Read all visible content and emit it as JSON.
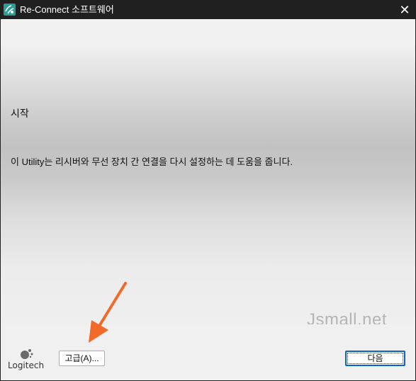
{
  "window": {
    "title": "Re-Connect 소프트웨어",
    "close_glyph": "✕"
  },
  "main": {
    "heading": "시작",
    "description": "이 Utility는 리시버와 무선 장치 간 연결을 다시 설정하는 데 도움을 줍니다.",
    "watermark": "Jsmall.net"
  },
  "footer": {
    "logo_text": "Logitech",
    "advanced_label": "고급(A)...",
    "next_label": "다음"
  },
  "colors": {
    "titlebar": "#202020",
    "app_icon": "#2b9e99",
    "arrow": "#f26a2a",
    "default_button_border": "#0a64c8"
  },
  "icons": [
    "app-icon",
    "close-icon",
    "logitech-logo-icon",
    "annotation-arrow-icon"
  ]
}
